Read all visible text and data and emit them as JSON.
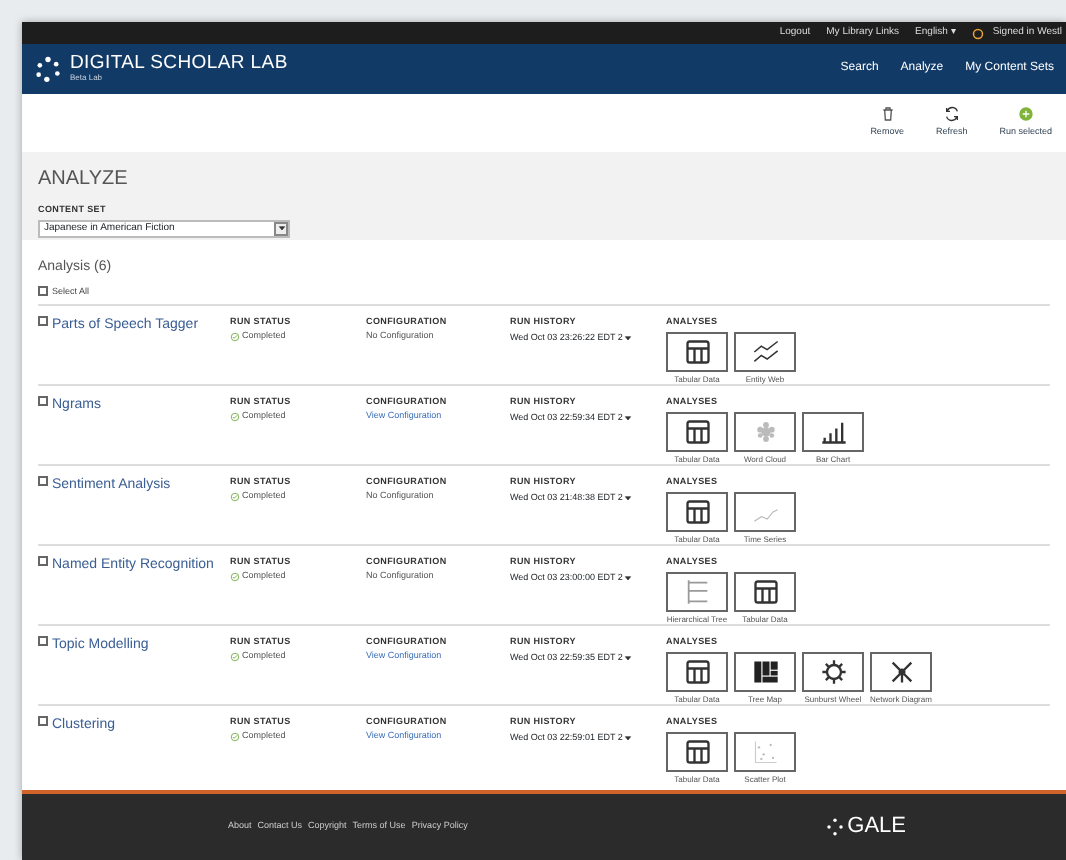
{
  "top_bar": {
    "links": [
      "Logout",
      "My Library Links",
      "English ▾",
      "Signed in Westl"
    ]
  },
  "header": {
    "title": "DIGITAL SCHOLAR LAB",
    "subtitle": "Beta Lab",
    "nav": [
      "Search",
      "Analyze",
      "My Content Sets"
    ]
  },
  "toolbar": [
    {
      "kind": "trash",
      "label": "Remove"
    },
    {
      "kind": "refresh",
      "label": "Refresh"
    },
    {
      "kind": "run",
      "label": "Run selected"
    }
  ],
  "page_title": "ANALYZE",
  "content_set": {
    "label": "CONTENT SET",
    "value": "Japanese in American Fiction"
  },
  "analysis_heading": "Analysis (6)",
  "select_all": {
    "label": "Select All",
    "checked": false
  },
  "analyses": [
    {
      "name": "Parts of Speech Tagger",
      "checked": false,
      "status_label": "RUN STATUS",
      "status": "Completed",
      "config_label": "CONFIGURATION",
      "config": "No Configuration",
      "config_link": false,
      "history_label": "RUN HISTORY",
      "history": "Wed Oct 03 23:26:22 EDT 2",
      "tiles_label": "ANALYSES",
      "tiles": [
        {
          "kind": "table",
          "label": "Tabular Data"
        },
        {
          "kind": "lines",
          "label": "Entity Web"
        }
      ]
    },
    {
      "name": "Ngrams",
      "checked": false,
      "status_label": "RUN STATUS",
      "status": "Completed",
      "config_label": "CONFIGURATION",
      "config": "View Configuration",
      "config_link": true,
      "history_label": "RUN HISTORY",
      "history": "Wed Oct 03 22:59:34 EDT 2",
      "tiles_label": "ANALYSES",
      "tiles": [
        {
          "kind": "table",
          "label": "Tabular Data"
        },
        {
          "kind": "cloud",
          "label": "Word Cloud"
        },
        {
          "kind": "bars",
          "label": "Bar Chart"
        }
      ]
    },
    {
      "name": "Sentiment Analysis",
      "checked": false,
      "status_label": "RUN STATUS",
      "status": "Completed",
      "config_label": "CONFIGURATION",
      "config": "No Configuration",
      "config_link": false,
      "history_label": "RUN HISTORY",
      "history": "Wed Oct 03 21:48:38 EDT 2",
      "tiles_label": "ANALYSES",
      "tiles": [
        {
          "kind": "table",
          "label": "Tabular Data"
        },
        {
          "kind": "series",
          "label": "Time Series"
        }
      ]
    },
    {
      "name": "Named Entity Recognition",
      "checked": false,
      "status_label": "RUN STATUS",
      "status": "Completed",
      "config_label": "CONFIGURATION",
      "config": "No Configuration",
      "config_link": false,
      "history_label": "RUN HISTORY",
      "history": "Wed Oct 03 23:00:00 EDT 2",
      "tiles_label": "ANALYSES",
      "tiles": [
        {
          "kind": "tree",
          "label": "Hierarchical Tree"
        },
        {
          "kind": "table",
          "label": "Tabular Data"
        }
      ]
    },
    {
      "name": "Topic Modelling",
      "checked": false,
      "status_label": "RUN STATUS",
      "status": "Completed",
      "config_label": "CONFIGURATION",
      "config": "View Configuration",
      "config_link": true,
      "history_label": "RUN HISTORY",
      "history": "Wed Oct 03 22:59:35 EDT 2",
      "tiles_label": "ANALYSES",
      "tiles": [
        {
          "kind": "table",
          "label": "Tabular Data"
        },
        {
          "kind": "treemap",
          "label": "Tree Map"
        },
        {
          "kind": "wheel",
          "label": "Sunburst Wheel"
        },
        {
          "kind": "network",
          "label": "Network Diagram"
        }
      ]
    },
    {
      "name": "Clustering",
      "checked": false,
      "status_label": "RUN STATUS",
      "status": "Completed",
      "config_label": "CONFIGURATION",
      "config": "View Configuration",
      "config_link": true,
      "history_label": "RUN HISTORY",
      "history": "Wed Oct 03 22:59:01 EDT 2",
      "tiles_label": "ANALYSES",
      "tiles": [
        {
          "kind": "table",
          "label": "Tabular Data"
        },
        {
          "kind": "scatter",
          "label": "Scatter Plot"
        }
      ]
    }
  ],
  "footer": {
    "links": [
      "About",
      "Contact Us",
      "Copyright",
      "Terms of Use",
      "Privacy Policy"
    ],
    "brand": "GALE"
  }
}
